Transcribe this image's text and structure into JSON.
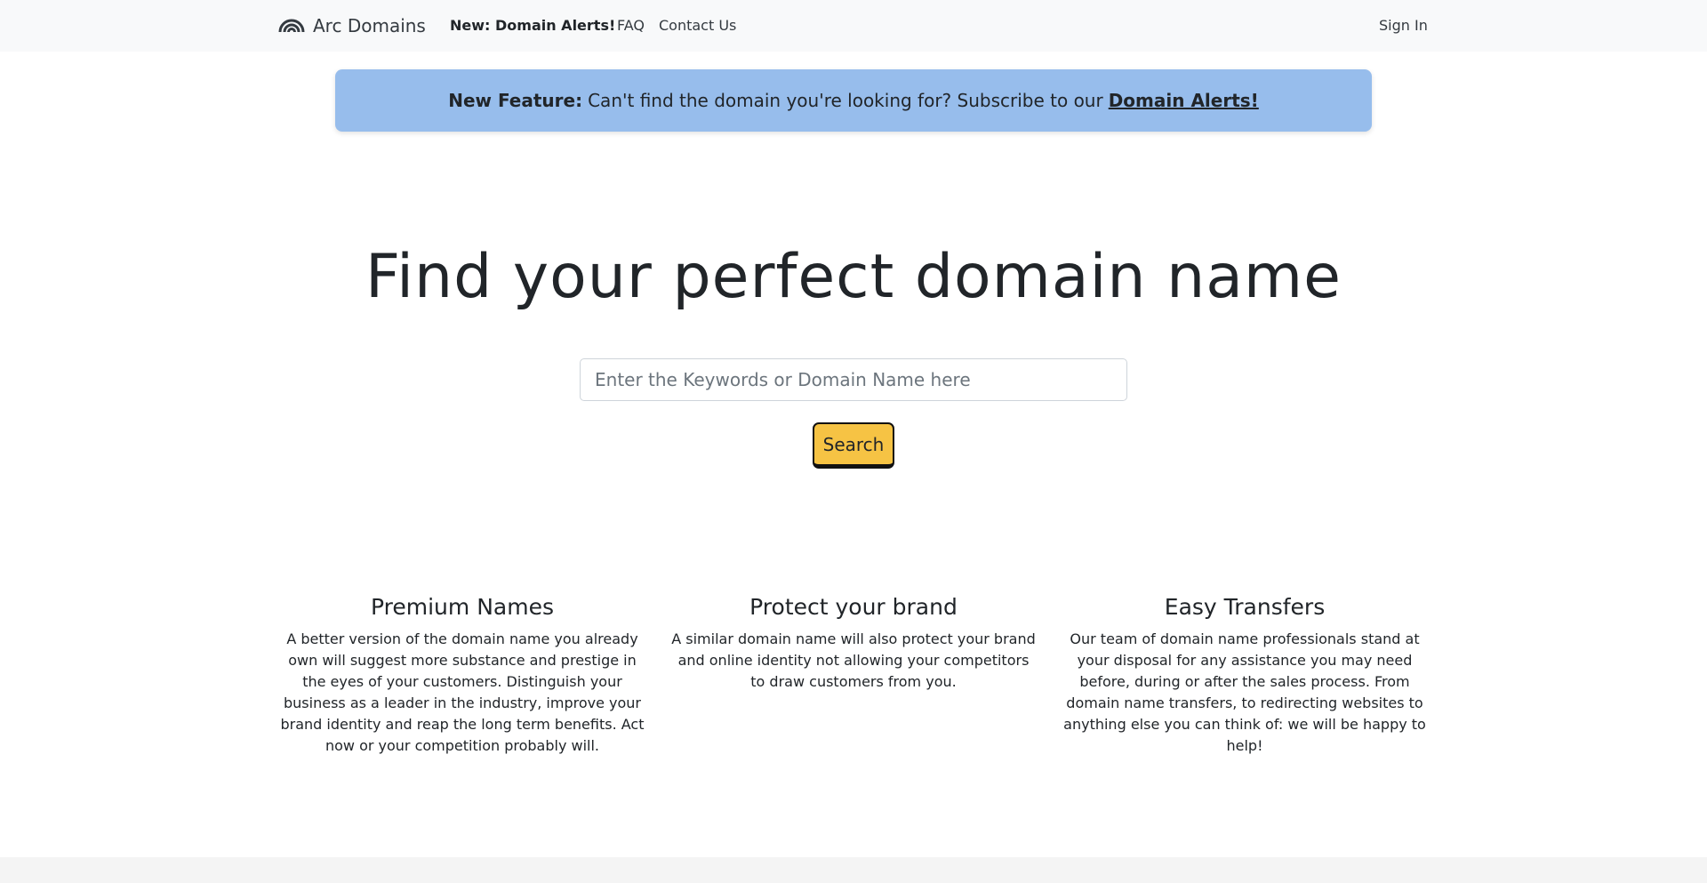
{
  "navbar": {
    "brand": "Arc Domains",
    "brand_icon": "rainbow-arc-icon",
    "alerts_link": "New: Domain Alerts!",
    "faq_link": "FAQ",
    "contact_link": "Contact Us",
    "signin_link": "Sign In"
  },
  "alert": {
    "label": "New Feature:",
    "text": "Can't find the domain you're looking for? Subscribe to our",
    "link": "Domain Alerts!",
    "color": "#97bdec"
  },
  "hero": {
    "title": "Find your perfect domain name",
    "search_placeholder": "Enter the Keywords or Domain Name here",
    "search_value": "",
    "search_button": "Search",
    "button_color": "#f6c344"
  },
  "features": [
    {
      "title": "Premium Names",
      "text": "A better version of the domain name you already own will suggest more substance and prestige in the eyes of your customers. Distinguish your business as a leader in the industry, improve your brand identity and reap the long term benefits. Act now or your competition probably will."
    },
    {
      "title": "Protect your brand",
      "text": "A similar domain name will also protect your brand and online identity not allowing your competitors to draw customers from you."
    },
    {
      "title": "Easy Transfers",
      "text": "Our team of domain name professionals stand at your disposal for any assistance you may need before, during or after the sales process. From domain name transfers, to redirecting websites to anything else you can think of: we will be happy to help!"
    }
  ]
}
